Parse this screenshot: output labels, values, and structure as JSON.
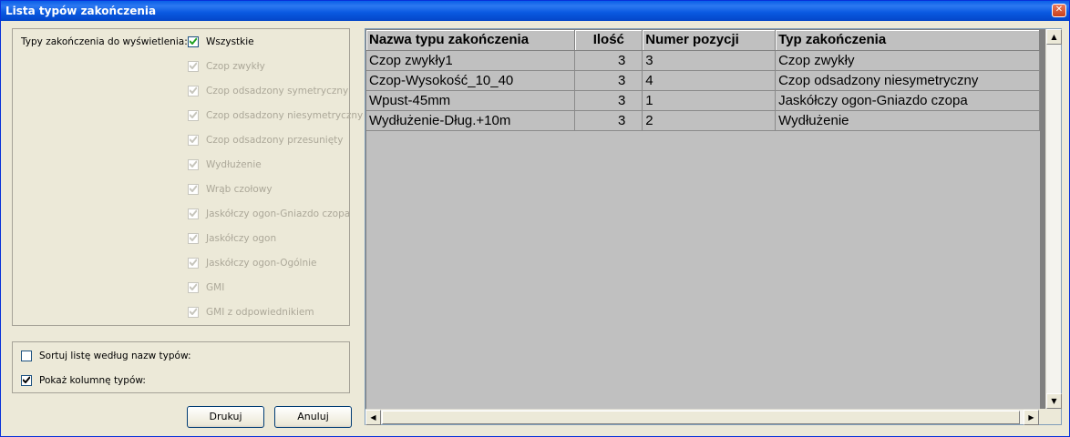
{
  "window": {
    "title": "Lista typów zakończenia"
  },
  "filter": {
    "label": "Typy zakończenia do wyświetlenia:",
    "all_label": "Wszystkie",
    "all_checked": true,
    "items": [
      {
        "label": "Czop zwykły",
        "checked": true,
        "enabled": false
      },
      {
        "label": "Czop odsadzony symetryczny",
        "checked": true,
        "enabled": false
      },
      {
        "label": "Czop odsadzony niesymetryczny",
        "checked": true,
        "enabled": false
      },
      {
        "label": "Czop odsadzony przesunięty",
        "checked": true,
        "enabled": false
      },
      {
        "label": "Wydłużenie",
        "checked": true,
        "enabled": false
      },
      {
        "label": "Wrąb czołowy",
        "checked": true,
        "enabled": false
      },
      {
        "label": "Jaskółczy ogon-Gniazdo czopa",
        "checked": true,
        "enabled": false
      },
      {
        "label": "Jaskółczy ogon",
        "checked": true,
        "enabled": false
      },
      {
        "label": "Jaskółczy ogon-Ogólnie",
        "checked": true,
        "enabled": false
      },
      {
        "label": "GMI",
        "checked": true,
        "enabled": false
      },
      {
        "label": "GMI z odpowiednikiem",
        "checked": true,
        "enabled": false
      }
    ]
  },
  "options": {
    "sort_label": "Sortuj listę według nazw typów:",
    "sort_checked": false,
    "show_type_label": "Pokaż kolumnę typów:",
    "show_type_checked": true
  },
  "buttons": {
    "print": "Drukuj",
    "cancel": "Anuluj"
  },
  "table": {
    "columns": [
      "Nazwa typu zakończenia",
      "Ilość",
      "Numer pozycji",
      "Typ zakończenia"
    ],
    "rows": [
      [
        "Czop zwykły1",
        "3",
        "3",
        "Czop zwykły"
      ],
      [
        "Czop-Wysokość_10_40",
        "3",
        "4",
        "Czop odsadzony niesymetryczny"
      ],
      [
        "Wpust-45mm",
        "3",
        "1",
        "Jaskółczy ogon-Gniazdo czopa"
      ],
      [
        "Wydłużenie-Dług.+10m",
        "3",
        "2",
        "Wydłużenie"
      ]
    ]
  },
  "icons": {
    "close": "close-icon",
    "scroll_up": "arrow-up-icon",
    "scroll_down": "arrow-down-icon",
    "scroll_left": "arrow-left-icon",
    "scroll_right": "arrow-right-icon"
  },
  "colors": {
    "titlebar": "#0a5fe8",
    "dialog_bg": "#ece9d8",
    "grid_bg": "#c0c0c0"
  }
}
